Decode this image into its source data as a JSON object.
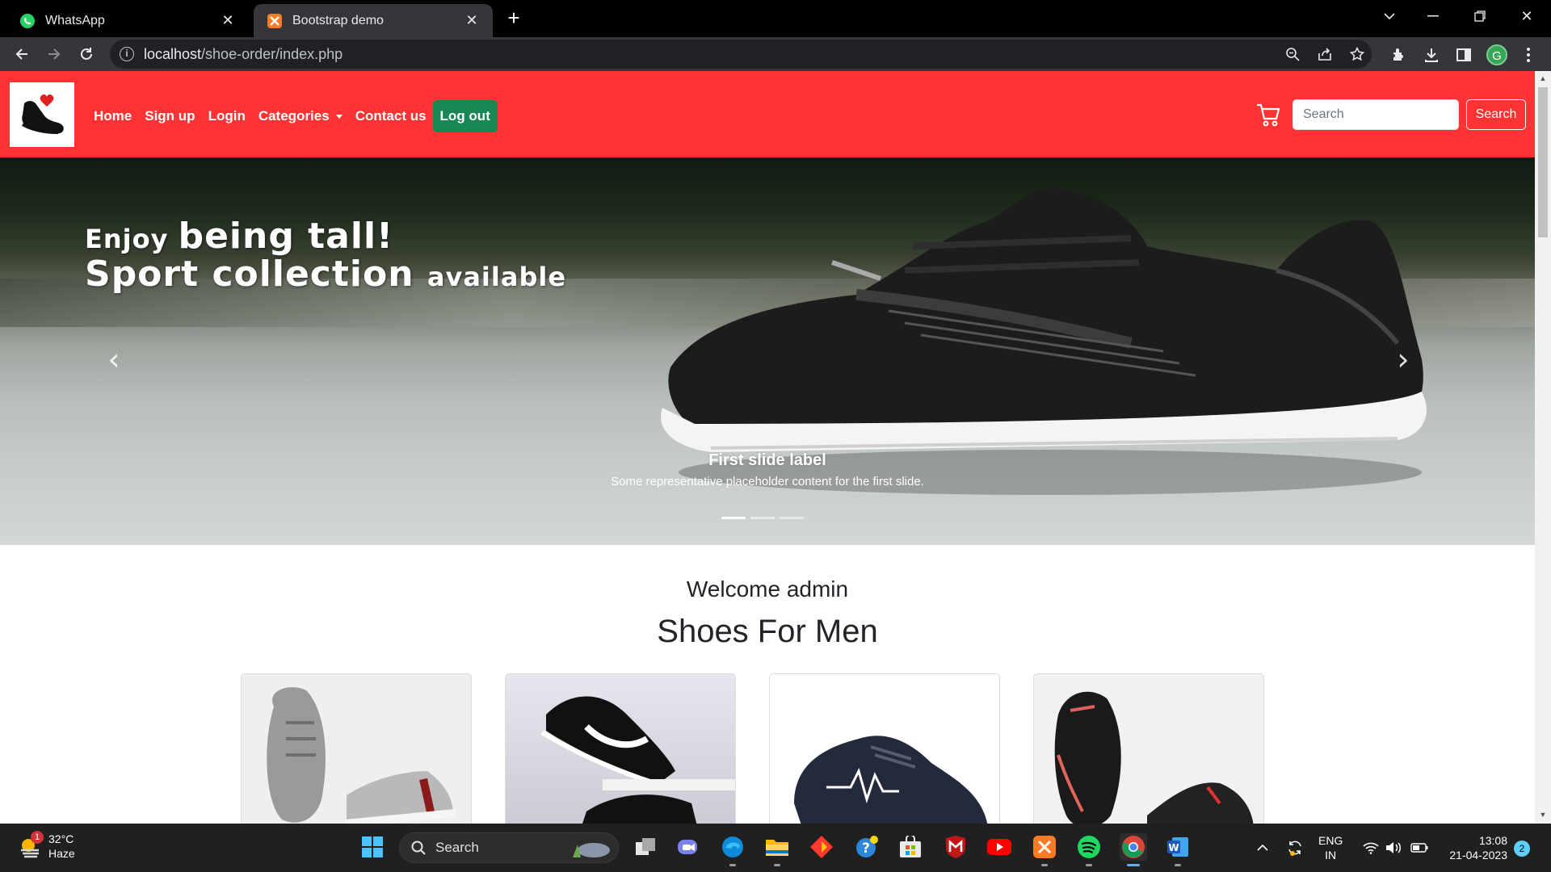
{
  "browser": {
    "tabs": [
      {
        "title": "WhatsApp",
        "icon": "whatsapp-icon",
        "active": false
      },
      {
        "title": "Bootstrap demo",
        "icon": "xampp-icon",
        "active": true
      }
    ],
    "url_host": "localhost",
    "url_path": "/shoe-order/index.php"
  },
  "site": {
    "nav": {
      "home": "Home",
      "signup": "Sign up",
      "login": "Login",
      "categories": "Categories",
      "contact": "Contact us",
      "logout": "Log out"
    },
    "search": {
      "placeholder": "Search",
      "button": "Search"
    },
    "carousel": {
      "headline_1a": "Enjoy ",
      "headline_1b": "being tall!",
      "headline_2a": "Sport collection ",
      "headline_2b": "available",
      "caption_title": "First slide label",
      "caption_text": "Some representative placeholder content for the first slide.",
      "slide_count": 3,
      "active_slide": 1
    },
    "welcome": "Welcome admin",
    "section_title": "Shoes For Men",
    "colors": {
      "navbar": "#ff3333",
      "logout": "#198754"
    }
  },
  "taskbar": {
    "weather_temp": "32°C",
    "weather_desc": "Haze",
    "weather_badge": "1",
    "search_label": "Search",
    "lang_1": "ENG",
    "lang_2": "IN",
    "time": "13:08",
    "date": "21-04-2023",
    "notifications": "2"
  }
}
